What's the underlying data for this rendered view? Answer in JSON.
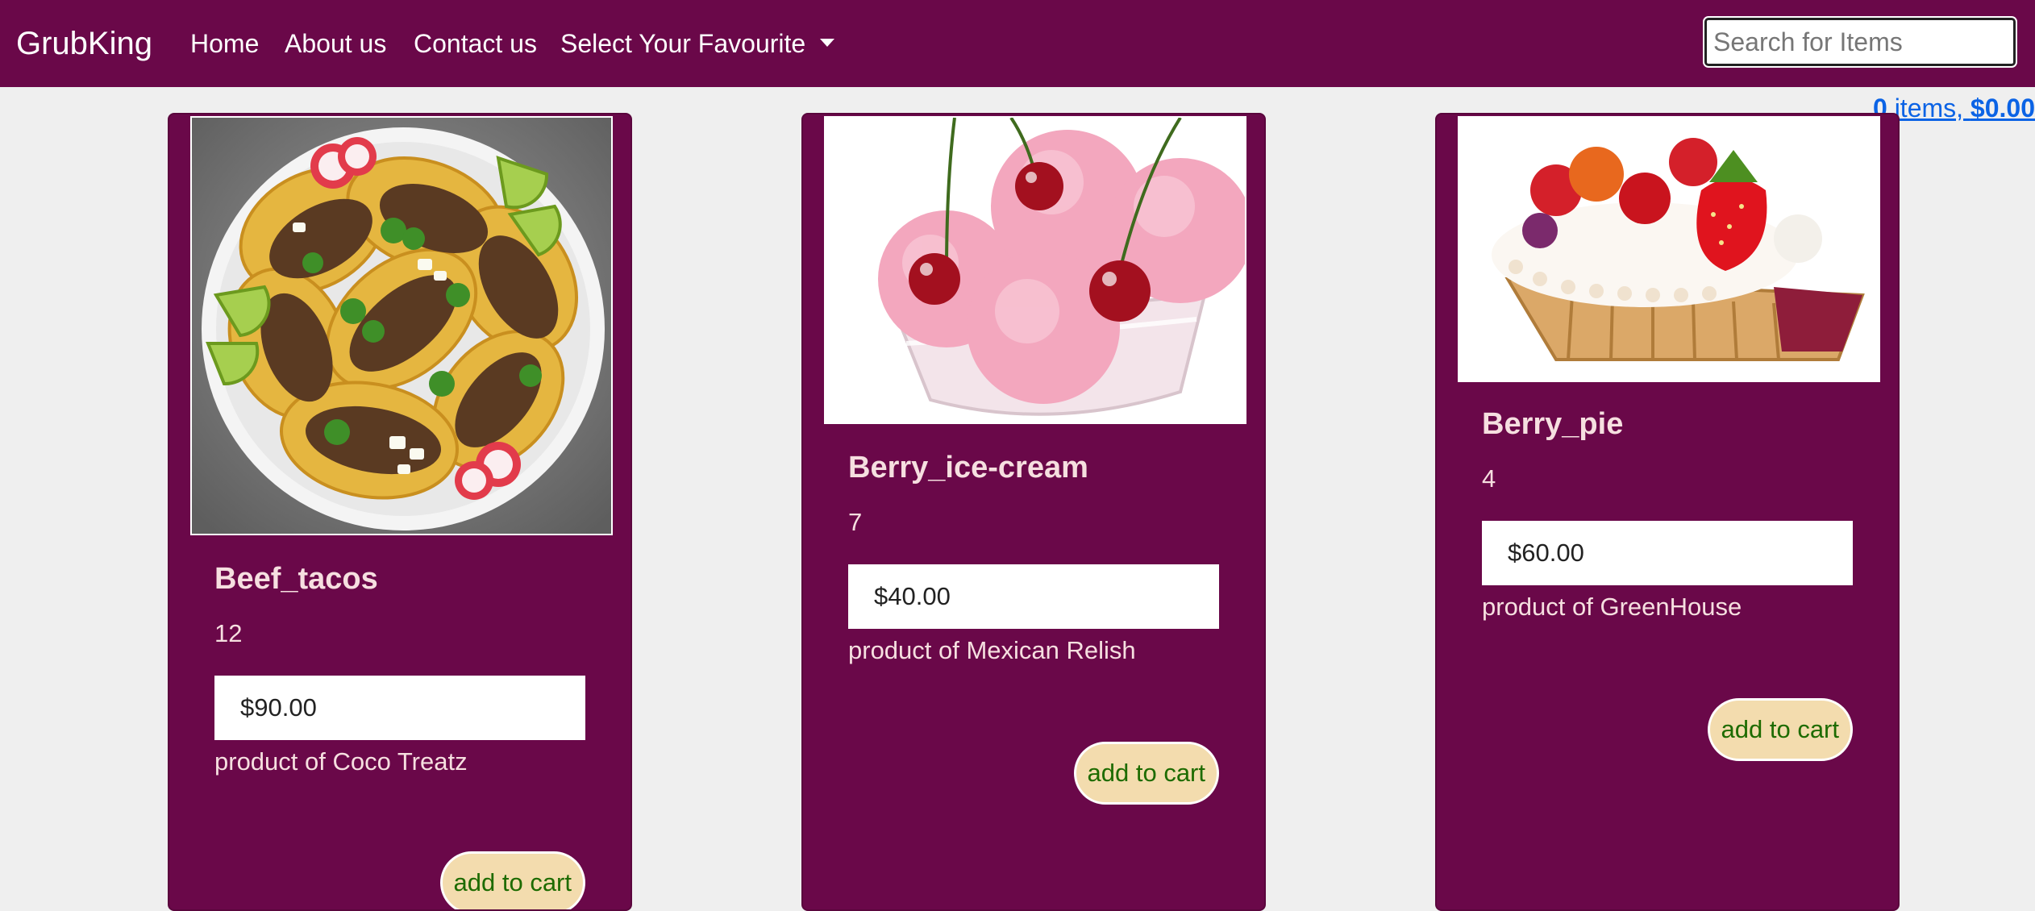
{
  "navbar": {
    "brand": "GrubKing",
    "links": [
      "Home",
      "About us",
      "Contact us"
    ],
    "dropdown_label": "Select Your Favourite",
    "search_placeholder": "Search for Items",
    "colors": {
      "background": "#6a0849",
      "text": "#ffffff"
    }
  },
  "cart": {
    "count": "0",
    "label_mid": " items, ",
    "total": "$0.00"
  },
  "products": [
    {
      "name": "Beef_tacos",
      "quantity": "12",
      "price": "$90.00",
      "vendor": "product of Coco Treatz",
      "button": "add to cart",
      "image": "taco-plate-image"
    },
    {
      "name": "Berry_ice-cream",
      "quantity": "7",
      "price": "$40.00",
      "vendor": "product of Mexican Relish",
      "button": "add to cart",
      "image": "ice-cream-cherries-image"
    },
    {
      "name": "Berry_pie",
      "quantity": "4",
      "price": "$60.00",
      "vendor": "product of GreenHouse",
      "button": "add to cart",
      "image": "berry-tart-image"
    }
  ],
  "colors": {
    "card": "#6a0849",
    "card_text": "#f6dfe0",
    "button_bg": "#f3dcae",
    "button_text": "#1d6b00",
    "cart_link": "#0b63e5",
    "page_bg": "#efefef"
  }
}
